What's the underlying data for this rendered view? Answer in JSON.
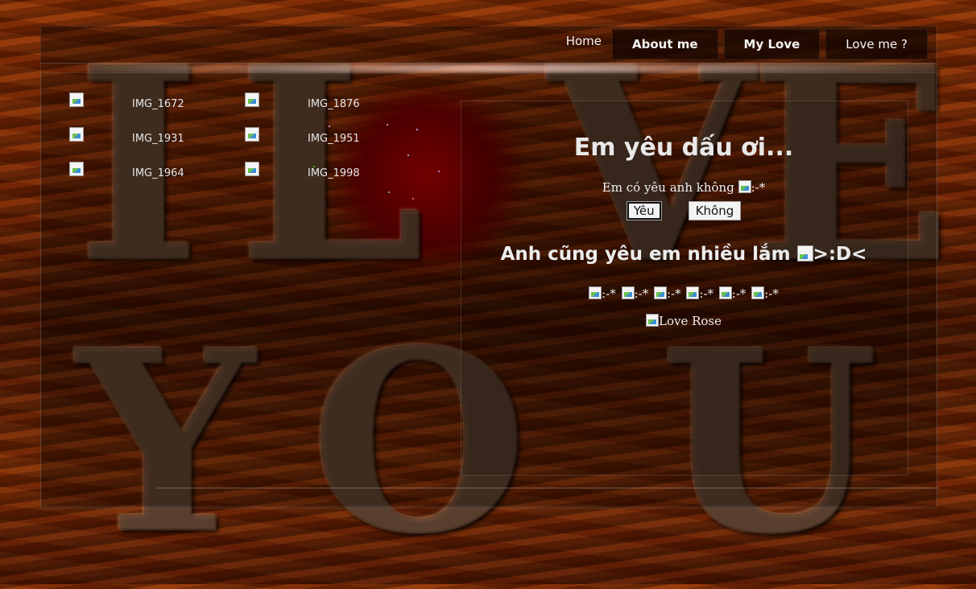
{
  "background": {
    "letters": [
      "I",
      "L",
      "V",
      "E",
      "Y",
      "O",
      "U"
    ],
    "accent_colors": {
      "wood": "#7a2c05",
      "heart": "#8b0000",
      "tab_bg": "#1a0602"
    }
  },
  "nav": {
    "home": "Home",
    "about": "About me",
    "mylove": "My Love",
    "loveme": "Love me ?"
  },
  "gallery": {
    "items": [
      {
        "name": "IMG_1672"
      },
      {
        "name": "IMG_1876"
      },
      {
        "name": "IMG_1931"
      },
      {
        "name": "IMG_1951"
      },
      {
        "name": "IMG_1964"
      },
      {
        "name": "IMG_1998"
      }
    ]
  },
  "main": {
    "title": "Em yêu dấu ơi...",
    "question": "Em có yêu anh không",
    "question_emoticon_alt": ":-*",
    "yes_label": "Yêu",
    "no_label": "Không",
    "answer": "Anh cũng yêu em nhiều lắm",
    "answer_emoticon_alt": ">:D<",
    "smileys": [
      ":-*",
      ":-*",
      ":-*",
      ":-*",
      ":-*",
      ":-*"
    ],
    "rose_alt": "Love Rose"
  }
}
